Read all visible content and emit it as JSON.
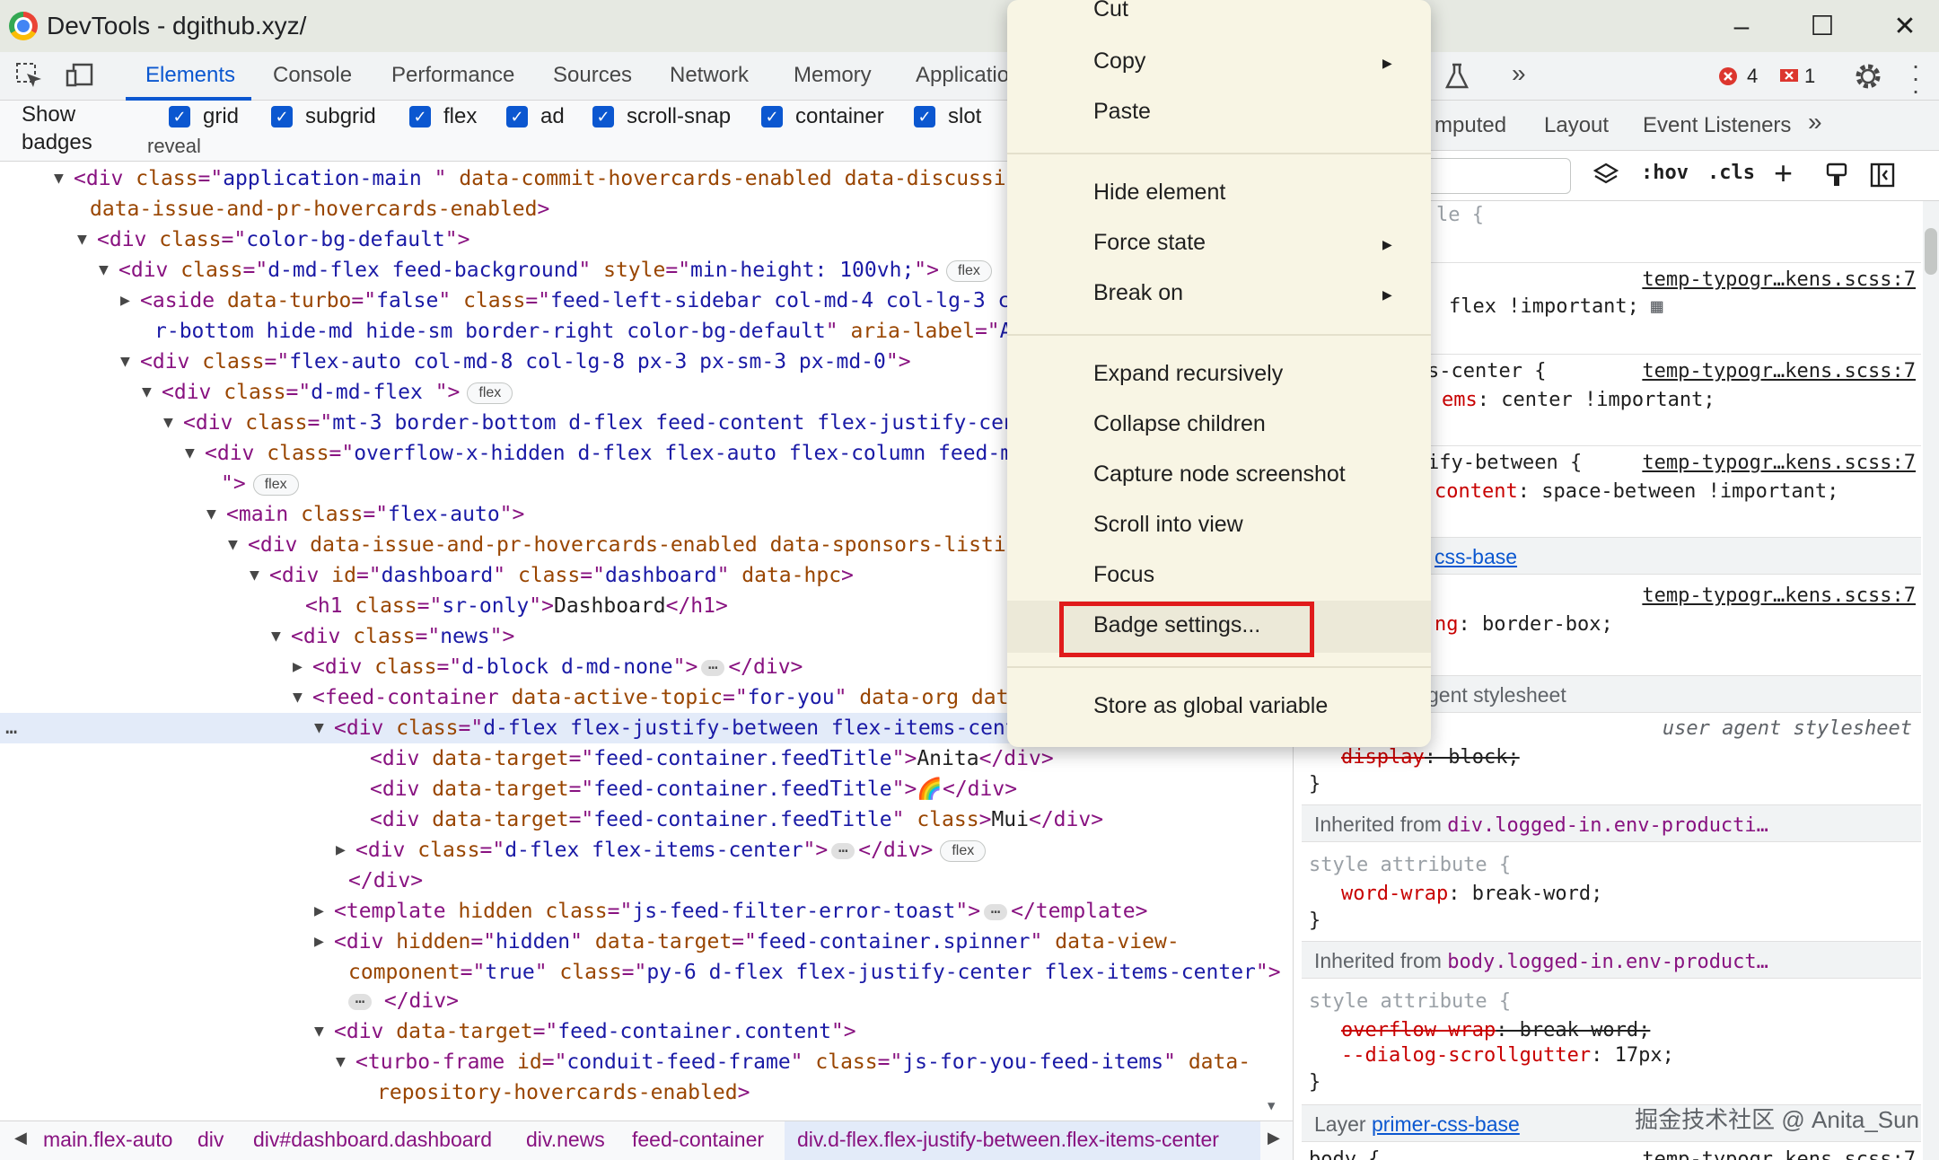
{
  "window": {
    "title": "DevTools - dgithub.xyz/"
  },
  "tabs": [
    "Elements",
    "Console",
    "Performance",
    "Sources",
    "Network",
    "Memory",
    "Applicatio"
  ],
  "issues": {
    "errors": "4",
    "warnings": "1"
  },
  "badge_bar": {
    "label_line1": "Show",
    "label_line2": "badges",
    "reveal": "reveal",
    "items": [
      "grid",
      "subgrid",
      "flex",
      "ad",
      "scroll-snap",
      "container",
      "slot"
    ]
  },
  "tree": {
    "rows": [
      {
        "seg": [
          [
            "tg",
            "<div "
          ],
          [
            "an",
            "class"
          ],
          [
            "tg",
            "=\""
          ],
          [
            "av",
            "application-main "
          ],
          [
            "tg",
            "\" "
          ],
          [
            "an",
            "data-commit-hovercards-enabled data-discussion"
          ]
        ]
      },
      {
        "seg": [
          [
            "an",
            "data-issue-and-pr-hovercards-enabled"
          ],
          [
            "tg",
            ">"
          ]
        ]
      },
      {
        "seg": [
          [
            "tg",
            "<div "
          ],
          [
            "an",
            "class"
          ],
          [
            "tg",
            "=\""
          ],
          [
            "av",
            "color-bg-default"
          ],
          [
            "tg",
            "\">"
          ]
        ]
      },
      {
        "seg": [
          [
            "tg",
            "<div "
          ],
          [
            "an",
            "class"
          ],
          [
            "tg",
            "=\""
          ],
          [
            "av",
            "d-md-flex feed-background"
          ],
          [
            "tg",
            "\" "
          ],
          [
            "an",
            "style"
          ],
          [
            "tg",
            "=\""
          ],
          [
            "av",
            "min-height: 100vh;"
          ],
          [
            "tg",
            "\">"
          ]
        ],
        "pill": "flex"
      },
      {
        "seg": [
          [
            "tg",
            "<aside "
          ],
          [
            "an",
            "data-turbo"
          ],
          [
            "tg",
            "=\""
          ],
          [
            "av",
            "false"
          ],
          [
            "tg",
            "\" "
          ],
          [
            "an",
            "class"
          ],
          [
            "tg",
            "=\""
          ],
          [
            "av",
            "feed-left-sidebar col-md-4 col-lg-3 col"
          ]
        ]
      },
      {
        "seg": [
          [
            "av",
            "r-bottom hide-md hide-sm border-right color-bg-default"
          ],
          [
            "tg",
            "\" "
          ],
          [
            "an",
            "aria-label"
          ],
          [
            "tg",
            "=\""
          ],
          [
            "av",
            "Acco"
          ]
        ]
      },
      {
        "seg": [
          [
            "tg",
            "<div "
          ],
          [
            "an",
            "class"
          ],
          [
            "tg",
            "=\""
          ],
          [
            "av",
            "flex-auto col-md-8 col-lg-8 px-3 px-sm-3 px-md-0"
          ],
          [
            "tg",
            "\">"
          ]
        ]
      },
      {
        "seg": [
          [
            "tg",
            "<div "
          ],
          [
            "an",
            "class"
          ],
          [
            "tg",
            "=\""
          ],
          [
            "av",
            "d-md-flex "
          ],
          [
            "tg",
            "\">"
          ]
        ],
        "pill": "flex"
      },
      {
        "seg": [
          [
            "tg",
            "<div "
          ],
          [
            "an",
            "class"
          ],
          [
            "tg",
            "=\""
          ],
          [
            "av",
            "mt-3 border-bottom d-flex feed-content flex-justify-cent"
          ]
        ]
      },
      {
        "seg": [
          [
            "tg",
            "<div "
          ],
          [
            "an",
            "class"
          ],
          [
            "tg",
            "=\""
          ],
          [
            "av",
            "overflow-x-hidden d-flex flex-auto flex-column feed-ma"
          ]
        ]
      },
      {
        "seg": [
          [
            "tg",
            "\">"
          ]
        ],
        "pill": "flex"
      },
      {
        "seg": [
          [
            "tg",
            "<main "
          ],
          [
            "an",
            "class"
          ],
          [
            "tg",
            "=\""
          ],
          [
            "av",
            "flex-auto"
          ],
          [
            "tg",
            "\">"
          ]
        ]
      },
      {
        "seg": [
          [
            "tg",
            "<div "
          ],
          [
            "an",
            "data-issue-and-pr-hovercards-enabled data-sponsors-listing"
          ]
        ]
      },
      {
        "seg": [
          [
            "tg",
            "<div "
          ],
          [
            "an",
            "id"
          ],
          [
            "tg",
            "=\""
          ],
          [
            "av",
            "dashboard"
          ],
          [
            "tg",
            "\" "
          ],
          [
            "an",
            "class"
          ],
          [
            "tg",
            "=\""
          ],
          [
            "av",
            "dashboard"
          ],
          [
            "tg",
            "\" "
          ],
          [
            "an",
            "data-hpc"
          ],
          [
            "tg",
            ">"
          ]
        ]
      },
      {
        "seg": [
          [
            "tg",
            "<h1 "
          ],
          [
            "an",
            "class"
          ],
          [
            "tg",
            "=\""
          ],
          [
            "av",
            "sr-only"
          ],
          [
            "tg",
            "\">"
          ],
          [
            "tx",
            "Dashboard"
          ],
          [
            "tg",
            "</h1>"
          ]
        ]
      },
      {
        "seg": [
          [
            "tg",
            "<div "
          ],
          [
            "an",
            "class"
          ],
          [
            "tg",
            "=\""
          ],
          [
            "av",
            "news"
          ],
          [
            "tg",
            "\">"
          ]
        ]
      },
      {
        "seg": [
          [
            "tg",
            "<div "
          ],
          [
            "an",
            "class"
          ],
          [
            "tg",
            "=\""
          ],
          [
            "av",
            "d-block d-md-none"
          ],
          [
            "tg",
            "\">"
          ]
        ],
        "ell": true,
        "after": "</div>"
      },
      {
        "seg": [
          [
            "tg",
            "<feed-container "
          ],
          [
            "an",
            "data-active-topic"
          ],
          [
            "tg",
            "=\""
          ],
          [
            "av",
            "for-you"
          ],
          [
            "tg",
            "\" "
          ],
          [
            "an",
            "data-org data"
          ]
        ]
      },
      {
        "seg": [
          [
            "tg",
            "<div "
          ],
          [
            "an",
            "class"
          ],
          [
            "tg",
            "=\""
          ],
          [
            "av",
            "d-flex flex-justify-between flex-items-center"
          ],
          [
            "tg",
            "\">"
          ]
        ],
        "pill": "flex",
        "tail": "== $0"
      },
      {
        "seg": [
          [
            "tg",
            "<div "
          ],
          [
            "an",
            "data-target"
          ],
          [
            "tg",
            "=\""
          ],
          [
            "av",
            "feed-container.feedTitle"
          ],
          [
            "tg",
            "\">"
          ],
          [
            "tx",
            "Anita"
          ],
          [
            "tg",
            "</div>"
          ]
        ]
      },
      {
        "seg": [
          [
            "tg",
            "<div "
          ],
          [
            "an",
            "data-target"
          ],
          [
            "tg",
            "=\""
          ],
          [
            "av",
            "feed-container.feedTitle"
          ],
          [
            "tg",
            "\">"
          ],
          [
            "tx",
            "🌈"
          ],
          [
            "tg",
            "</div>"
          ]
        ]
      },
      {
        "seg": [
          [
            "tg",
            "<div "
          ],
          [
            "an",
            "data-target"
          ],
          [
            "tg",
            "=\""
          ],
          [
            "av",
            "feed-container.feedTitle"
          ],
          [
            "tg",
            "\" "
          ],
          [
            "an",
            "class"
          ],
          [
            "tg",
            ">"
          ],
          [
            "tx",
            "Mui"
          ],
          [
            "tg",
            "</div>"
          ]
        ]
      },
      {
        "seg": [
          [
            "tg",
            "<div "
          ],
          [
            "an",
            "class"
          ],
          [
            "tg",
            "=\""
          ],
          [
            "av",
            "d-flex flex-items-center"
          ],
          [
            "tg",
            "\">"
          ]
        ],
        "ell": true,
        "after": "</div>",
        "pill": "flex"
      },
      {
        "seg": [
          [
            "tg",
            "</div>"
          ]
        ]
      },
      {
        "seg": [
          [
            "tg",
            "<template "
          ],
          [
            "an",
            "hidden class"
          ],
          [
            "tg",
            "=\""
          ],
          [
            "av",
            "js-feed-filter-error-toast"
          ],
          [
            "tg",
            "\">"
          ]
        ],
        "ell": true,
        "after": "</template>"
      },
      {
        "seg": [
          [
            "tg",
            "<div "
          ],
          [
            "an",
            "hidden"
          ],
          [
            "tg",
            "=\""
          ],
          [
            "av",
            "hidden"
          ],
          [
            "tg",
            "\" "
          ],
          [
            "an",
            "data-target"
          ],
          [
            "tg",
            "=\""
          ],
          [
            "av",
            "feed-container.spinner"
          ],
          [
            "tg",
            "\" "
          ],
          [
            "an",
            "data-view-"
          ]
        ]
      },
      {
        "seg": [
          [
            "an",
            "component"
          ],
          [
            "tg",
            "=\""
          ],
          [
            "av",
            "true"
          ],
          [
            "tg",
            "\" "
          ],
          [
            "an",
            "class"
          ],
          [
            "tg",
            "=\""
          ],
          [
            "av",
            "py-6 d-flex flex-justify-center flex-items-center"
          ],
          [
            "tg",
            "\">"
          ]
        ]
      },
      {
        "seg": [
          [
            "tg",
            "</div>"
          ]
        ],
        "ell_before": true
      },
      {
        "seg": [
          [
            "tg",
            "<div "
          ],
          [
            "an",
            "data-target"
          ],
          [
            "tg",
            "=\""
          ],
          [
            "av",
            "feed-container.content"
          ],
          [
            "tg",
            "\">"
          ]
        ]
      },
      {
        "seg": [
          [
            "tg",
            "<turbo-frame "
          ],
          [
            "an",
            "id"
          ],
          [
            "tg",
            "=\""
          ],
          [
            "av",
            "conduit-feed-frame"
          ],
          [
            "tg",
            "\" "
          ],
          [
            "an",
            "class"
          ],
          [
            "tg",
            "=\""
          ],
          [
            "av",
            "js-for-you-feed-items"
          ],
          [
            "tg",
            "\" "
          ],
          [
            "an",
            "data-"
          ]
        ]
      },
      {
        "seg": [
          [
            "an",
            "repository-hovercards-enabled"
          ],
          [
            "tg",
            ">"
          ]
        ]
      }
    ]
  },
  "breadcrumbs": [
    "main.flex-auto",
    "div",
    "div#dashboard.dashboard",
    "div.news",
    "feed-container",
    "div.d-flex.flex-justify-between.flex-items-center"
  ],
  "styles_tabs": [
    "mputed",
    "Layout",
    "Event Listeners"
  ],
  "styles_toolbar": {
    "hov": ":hov",
    "cls": ".cls"
  },
  "styles": {
    "frag_style": "le {",
    "src1": "temp-typogr…kens.scss:7",
    "flex_important": "flex !important;",
    "frag_center": "s-center {",
    "src2": "temp-typogr…kens.scss:7",
    "items_prop": "ems",
    "items_val": ": center !important;",
    "frag_between": "ify-between {",
    "src3": "temp-typogr…kens.scss:7",
    "content_prop": "content",
    "content_val": ": space-between !important;",
    "layer_frag": "css-base",
    "src4": "temp-typogr…kens.scss:7",
    "ng_prop": "ng",
    "ng_val": ": border-box;",
    "agent_frag": "gent stylesheet",
    "ua_label": "user agent stylesheet",
    "display_prop": "display",
    "display_val": ": block;",
    "brace": "}",
    "inherited1_label": "Inherited from ",
    "inherited1_sel": "div.logged-in.env-producti…",
    "style_attr": "style attribute {",
    "wordwrap_prop": "word-wrap",
    "wordwrap_val": ": break-word;",
    "inherited2_label": "Inherited from ",
    "inherited2_sel": "body.logged-in.env-product…",
    "style_attr2": "style attribute {",
    "overflow_prop": "overflow-wrap",
    "overflow_val": ": break-word;",
    "dialog_prop": "--dialog-scrollgutter",
    "dialog_val": ": 17px;",
    "layer_label": "Layer ",
    "layer_link": "primer-css-base",
    "body_frag": "body {",
    "src5": "temp-typogr…kens.scss:7"
  },
  "watermark": "掘金技术社区 @ Anita_Sun",
  "context_menu": {
    "items": [
      {
        "label": "Cut"
      },
      {
        "label": "Copy",
        "submenu": true
      },
      {
        "label": "Paste"
      },
      {
        "label": "Hide element"
      },
      {
        "label": "Force state",
        "submenu": true
      },
      {
        "label": "Break on",
        "submenu": true
      },
      {
        "label": "Expand recursively"
      },
      {
        "label": "Collapse children"
      },
      {
        "label": "Capture node screenshot"
      },
      {
        "label": "Scroll into view"
      },
      {
        "label": "Focus"
      },
      {
        "label": "Badge settings..."
      },
      {
        "label": "Store as global variable"
      }
    ],
    "highlighted": "Badge settings..."
  },
  "colors": {
    "accent": "#0b57d0",
    "tag": "#881280",
    "attr_name": "#994500",
    "attr_value": "#1a1aa6",
    "menu_bg": "#f8f5e4",
    "highlight_box": "#e01b1b"
  }
}
